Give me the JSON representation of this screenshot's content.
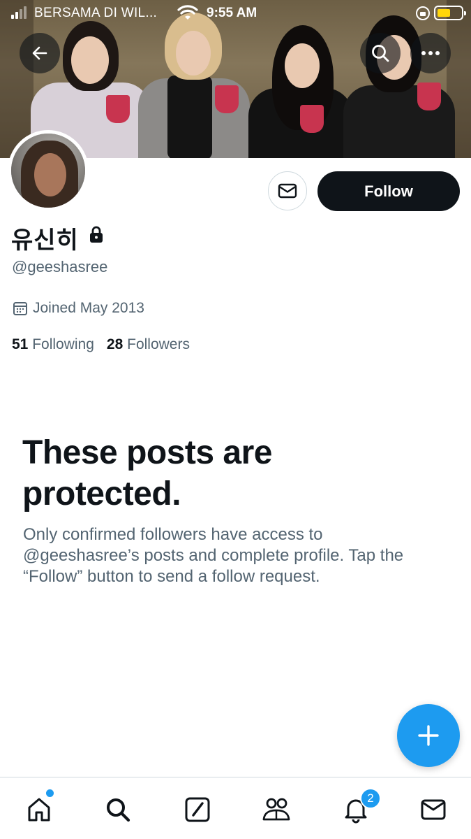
{
  "status_bar": {
    "carrier": "BERSAMA DI WIL...",
    "time": "9:55 AM",
    "battery_color": "#ffd60a"
  },
  "header": {
    "back_icon": "arrow-left-icon",
    "search_icon": "search-icon",
    "more_icon": "more-horizontal-icon"
  },
  "profile": {
    "display_name": "유신히",
    "handle": "@geeshasree",
    "protected_icon": "lock-icon",
    "joined": "Joined May 2013",
    "following_count": "51",
    "following_label": "Following",
    "followers_count": "28",
    "followers_label": "Followers"
  },
  "actions": {
    "message_icon": "mail-icon",
    "follow_label": "Follow"
  },
  "protected_notice": {
    "title": "These posts are protected.",
    "body": "Only confirmed followers have access to @geeshasree’s posts and complete profile. Tap the “Follow” button to send a follow request."
  },
  "fab": {
    "icon": "plus-icon"
  },
  "bottom_nav": {
    "items": [
      {
        "name": "home",
        "icon": "home-icon"
      },
      {
        "name": "search",
        "icon": "search-icon"
      },
      {
        "name": "compose",
        "icon": "compose-icon"
      },
      {
        "name": "communities",
        "icon": "people-icon"
      },
      {
        "name": "notifications",
        "icon": "bell-icon"
      },
      {
        "name": "messages",
        "icon": "mail-icon"
      }
    ],
    "notifications_badge": "2"
  },
  "colors": {
    "accent": "#1d9bf0",
    "text_primary": "#0f1419",
    "text_secondary": "#536471",
    "border": "#cfd9de"
  }
}
